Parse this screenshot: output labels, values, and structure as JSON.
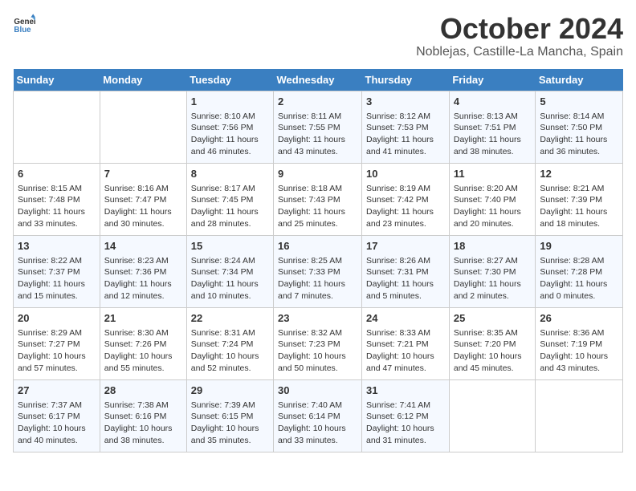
{
  "header": {
    "logo_general": "General",
    "logo_blue": "Blue",
    "title": "October 2024",
    "subtitle": "Noblejas, Castille-La Mancha, Spain"
  },
  "weekdays": [
    "Sunday",
    "Monday",
    "Tuesday",
    "Wednesday",
    "Thursday",
    "Friday",
    "Saturday"
  ],
  "weeks": [
    [
      {
        "day": "",
        "info": ""
      },
      {
        "day": "",
        "info": ""
      },
      {
        "day": "1",
        "info": "Sunrise: 8:10 AM\nSunset: 7:56 PM\nDaylight: 11 hours and 46 minutes."
      },
      {
        "day": "2",
        "info": "Sunrise: 8:11 AM\nSunset: 7:55 PM\nDaylight: 11 hours and 43 minutes."
      },
      {
        "day": "3",
        "info": "Sunrise: 8:12 AM\nSunset: 7:53 PM\nDaylight: 11 hours and 41 minutes."
      },
      {
        "day": "4",
        "info": "Sunrise: 8:13 AM\nSunset: 7:51 PM\nDaylight: 11 hours and 38 minutes."
      },
      {
        "day": "5",
        "info": "Sunrise: 8:14 AM\nSunset: 7:50 PM\nDaylight: 11 hours and 36 minutes."
      }
    ],
    [
      {
        "day": "6",
        "info": "Sunrise: 8:15 AM\nSunset: 7:48 PM\nDaylight: 11 hours and 33 minutes."
      },
      {
        "day": "7",
        "info": "Sunrise: 8:16 AM\nSunset: 7:47 PM\nDaylight: 11 hours and 30 minutes."
      },
      {
        "day": "8",
        "info": "Sunrise: 8:17 AM\nSunset: 7:45 PM\nDaylight: 11 hours and 28 minutes."
      },
      {
        "day": "9",
        "info": "Sunrise: 8:18 AM\nSunset: 7:43 PM\nDaylight: 11 hours and 25 minutes."
      },
      {
        "day": "10",
        "info": "Sunrise: 8:19 AM\nSunset: 7:42 PM\nDaylight: 11 hours and 23 minutes."
      },
      {
        "day": "11",
        "info": "Sunrise: 8:20 AM\nSunset: 7:40 PM\nDaylight: 11 hours and 20 minutes."
      },
      {
        "day": "12",
        "info": "Sunrise: 8:21 AM\nSunset: 7:39 PM\nDaylight: 11 hours and 18 minutes."
      }
    ],
    [
      {
        "day": "13",
        "info": "Sunrise: 8:22 AM\nSunset: 7:37 PM\nDaylight: 11 hours and 15 minutes."
      },
      {
        "day": "14",
        "info": "Sunrise: 8:23 AM\nSunset: 7:36 PM\nDaylight: 11 hours and 12 minutes."
      },
      {
        "day": "15",
        "info": "Sunrise: 8:24 AM\nSunset: 7:34 PM\nDaylight: 11 hours and 10 minutes."
      },
      {
        "day": "16",
        "info": "Sunrise: 8:25 AM\nSunset: 7:33 PM\nDaylight: 11 hours and 7 minutes."
      },
      {
        "day": "17",
        "info": "Sunrise: 8:26 AM\nSunset: 7:31 PM\nDaylight: 11 hours and 5 minutes."
      },
      {
        "day": "18",
        "info": "Sunrise: 8:27 AM\nSunset: 7:30 PM\nDaylight: 11 hours and 2 minutes."
      },
      {
        "day": "19",
        "info": "Sunrise: 8:28 AM\nSunset: 7:28 PM\nDaylight: 11 hours and 0 minutes."
      }
    ],
    [
      {
        "day": "20",
        "info": "Sunrise: 8:29 AM\nSunset: 7:27 PM\nDaylight: 10 hours and 57 minutes."
      },
      {
        "day": "21",
        "info": "Sunrise: 8:30 AM\nSunset: 7:26 PM\nDaylight: 10 hours and 55 minutes."
      },
      {
        "day": "22",
        "info": "Sunrise: 8:31 AM\nSunset: 7:24 PM\nDaylight: 10 hours and 52 minutes."
      },
      {
        "day": "23",
        "info": "Sunrise: 8:32 AM\nSunset: 7:23 PM\nDaylight: 10 hours and 50 minutes."
      },
      {
        "day": "24",
        "info": "Sunrise: 8:33 AM\nSunset: 7:21 PM\nDaylight: 10 hours and 47 minutes."
      },
      {
        "day": "25",
        "info": "Sunrise: 8:35 AM\nSunset: 7:20 PM\nDaylight: 10 hours and 45 minutes."
      },
      {
        "day": "26",
        "info": "Sunrise: 8:36 AM\nSunset: 7:19 PM\nDaylight: 10 hours and 43 minutes."
      }
    ],
    [
      {
        "day": "27",
        "info": "Sunrise: 7:37 AM\nSunset: 6:17 PM\nDaylight: 10 hours and 40 minutes."
      },
      {
        "day": "28",
        "info": "Sunrise: 7:38 AM\nSunset: 6:16 PM\nDaylight: 10 hours and 38 minutes."
      },
      {
        "day": "29",
        "info": "Sunrise: 7:39 AM\nSunset: 6:15 PM\nDaylight: 10 hours and 35 minutes."
      },
      {
        "day": "30",
        "info": "Sunrise: 7:40 AM\nSunset: 6:14 PM\nDaylight: 10 hours and 33 minutes."
      },
      {
        "day": "31",
        "info": "Sunrise: 7:41 AM\nSunset: 6:12 PM\nDaylight: 10 hours and 31 minutes."
      },
      {
        "day": "",
        "info": ""
      },
      {
        "day": "",
        "info": ""
      }
    ]
  ]
}
